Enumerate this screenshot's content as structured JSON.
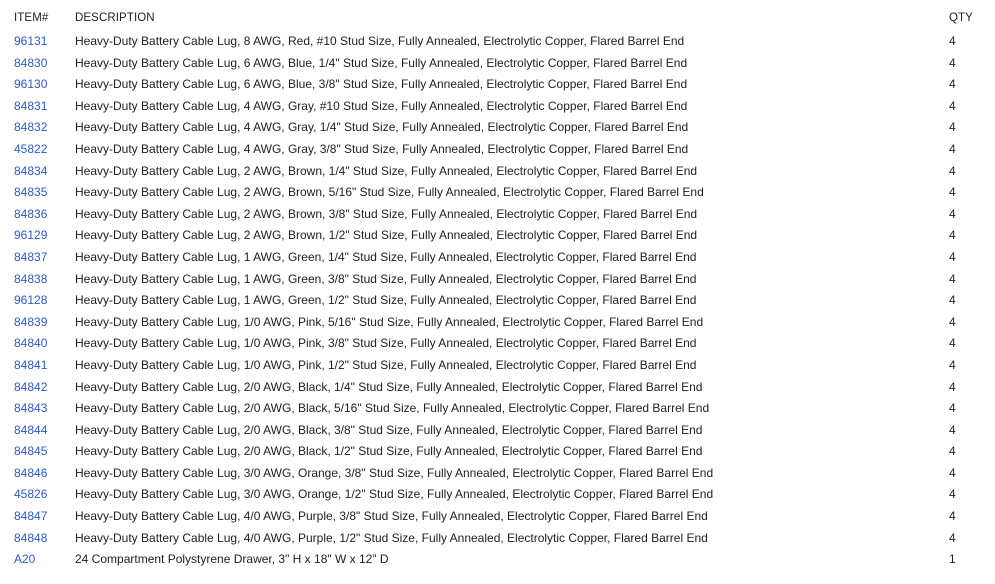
{
  "table": {
    "headers": {
      "item": "ITEM#",
      "description": "DESCRIPTION",
      "qty": "QTY"
    },
    "rows": [
      {
        "item": "96131",
        "description": "Heavy-Duty Battery Cable Lug, 8 AWG, Red, #10 Stud Size, Fully Annealed, Electrolytic Copper, Flared Barrel End",
        "qty": "4"
      },
      {
        "item": "84830",
        "description": "Heavy-Duty Battery Cable Lug, 6 AWG, Blue, 1/4\" Stud Size, Fully Annealed, Electrolytic Copper, Flared Barrel End",
        "qty": "4"
      },
      {
        "item": "96130",
        "description": "Heavy-Duty Battery Cable Lug, 6 AWG, Blue, 3/8\" Stud Size, Fully Annealed, Electrolytic Copper, Flared Barrel End",
        "qty": "4"
      },
      {
        "item": "84831",
        "description": "Heavy-Duty Battery Cable Lug, 4 AWG, Gray, #10 Stud Size, Fully Annealed, Electrolytic Copper, Flared Barrel End",
        "qty": "4"
      },
      {
        "item": "84832",
        "description": "Heavy-Duty Battery Cable Lug, 4 AWG, Gray, 1/4\" Stud Size, Fully Annealed, Electrolytic Copper, Flared Barrel End",
        "qty": "4"
      },
      {
        "item": "45822",
        "description": "Heavy-Duty Battery Cable Lug, 4 AWG, Gray, 3/8\" Stud Size, Fully Annealed, Electrolytic Copper, Flared Barrel End",
        "qty": "4"
      },
      {
        "item": "84834",
        "description": "Heavy-Duty Battery Cable Lug, 2 AWG, Brown, 1/4\" Stud Size, Fully Annealed, Electrolytic Copper, Flared Barrel End",
        "qty": "4"
      },
      {
        "item": "84835",
        "description": "Heavy-Duty Battery Cable Lug, 2 AWG, Brown, 5/16\" Stud Size, Fully Annealed, Electrolytic Copper, Flared Barrel End",
        "qty": "4"
      },
      {
        "item": "84836",
        "description": "Heavy-Duty Battery Cable Lug, 2 AWG, Brown, 3/8\" Stud Size, Fully Annealed, Electrolytic Copper, Flared Barrel End",
        "qty": "4"
      },
      {
        "item": "96129",
        "description": "Heavy-Duty Battery Cable Lug, 2 AWG, Brown, 1/2\" Stud Size, Fully Annealed, Electrolytic Copper, Flared Barrel End",
        "qty": "4"
      },
      {
        "item": "84837",
        "description": "Heavy-Duty Battery Cable Lug, 1 AWG, Green, 1/4\" Stud Size, Fully Annealed, Electrolytic Copper, Flared Barrel End",
        "qty": "4"
      },
      {
        "item": "84838",
        "description": "Heavy-Duty Battery Cable Lug, 1 AWG, Green, 3/8\" Stud Size, Fully Annealed, Electrolytic Copper, Flared Barrel End",
        "qty": "4"
      },
      {
        "item": "96128",
        "description": "Heavy-Duty Battery Cable Lug, 1 AWG, Green, 1/2\" Stud Size, Fully Annealed, Electrolytic Copper, Flared Barrel End",
        "qty": "4"
      },
      {
        "item": "84839",
        "description": "Heavy-Duty Battery Cable Lug, 1/0 AWG, Pink, 5/16\" Stud Size, Fully Annealed, Electrolytic Copper, Flared Barrel End",
        "qty": "4"
      },
      {
        "item": "84840",
        "description": "Heavy-Duty Battery Cable Lug, 1/0 AWG, Pink, 3/8\" Stud Size, Fully Annealed, Electrolytic Copper, Flared Barrel End",
        "qty": "4"
      },
      {
        "item": "84841",
        "description": "Heavy-Duty Battery Cable Lug, 1/0 AWG, Pink, 1/2\" Stud Size, Fully Annealed, Electrolytic Copper, Flared Barrel End",
        "qty": "4"
      },
      {
        "item": "84842",
        "description": "Heavy-Duty Battery Cable Lug, 2/0 AWG, Black, 1/4\" Stud Size, Fully Annealed, Electrolytic Copper, Flared Barrel End",
        "qty": "4"
      },
      {
        "item": "84843",
        "description": "Heavy-Duty Battery Cable Lug, 2/0 AWG, Black, 5/16\" Stud Size, Fully Annealed, Electrolytic Copper, Flared Barrel End",
        "qty": "4"
      },
      {
        "item": "84844",
        "description": "Heavy-Duty Battery Cable Lug, 2/0 AWG, Black, 3/8\" Stud Size, Fully Annealed, Electrolytic Copper, Flared Barrel End",
        "qty": "4"
      },
      {
        "item": "84845",
        "description": "Heavy-Duty Battery Cable Lug, 2/0 AWG, Black, 1/2\" Stud Size, Fully Annealed, Electrolytic Copper, Flared Barrel End",
        "qty": "4"
      },
      {
        "item": "84846",
        "description": "Heavy-Duty Battery Cable Lug, 3/0 AWG, Orange, 3/8\" Stud Size, Fully Annealed, Electrolytic Copper, Flared Barrel End",
        "qty": "4"
      },
      {
        "item": "45826",
        "description": "Heavy-Duty Battery Cable Lug, 3/0 AWG, Orange, 1/2\" Stud Size, Fully Annealed, Electrolytic Copper, Flared Barrel End",
        "qty": "4"
      },
      {
        "item": "84847",
        "description": "Heavy-Duty Battery Cable Lug, 4/0 AWG, Purple, 3/8\" Stud Size, Fully Annealed, Electrolytic Copper, Flared Barrel End",
        "qty": "4"
      },
      {
        "item": "84848",
        "description": "Heavy-Duty Battery Cable Lug, 4/0 AWG, Purple, 1/2\" Stud Size, Fully Annealed, Electrolytic Copper, Flared Barrel End",
        "qty": "4"
      },
      {
        "item": "A20",
        "description": "24 Compartment Polystyrene Drawer, 3\" H x 18\" W x 12\" D",
        "qty": "1"
      }
    ]
  },
  "colors": {
    "link": "#2f58c8",
    "text": "#212121",
    "background": "#ffffff"
  }
}
